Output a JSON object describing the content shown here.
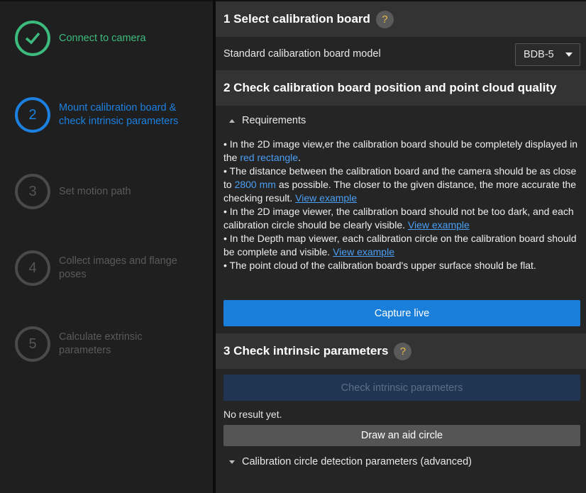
{
  "sidebar": {
    "steps": [
      {
        "num": "✓",
        "label": "Connect to camera",
        "state": "done"
      },
      {
        "num": "2",
        "label": "Mount calibration board & check intrinsic parameters",
        "state": "active"
      },
      {
        "num": "3",
        "label": "Set motion path",
        "state": "pending"
      },
      {
        "num": "4",
        "label": "Collect images and flange poses",
        "state": "pending"
      },
      {
        "num": "5",
        "label": "Calculate extrinsic parameters",
        "state": "pending"
      }
    ]
  },
  "section1": {
    "title": "1 Select calibration board",
    "help": "?",
    "model_label": "Standard calibaration board model",
    "model_value": "BDB-5"
  },
  "section2": {
    "title": "2 Check calibration board position and point cloud quality",
    "requirements_label": "Requirements",
    "t1a": "• In the 2D image view,er the calibration board should be completely displayed in the ",
    "t1b": "red rectangle",
    "t1c": ".",
    "t2a": "• The distance between the calibration board and the camera should be as close to ",
    "t2b": "2800 mm",
    "t2c": " as possible. The closer to the given distance, the more accurate the checking result. ",
    "link": "View example",
    "t3a": "• In the 2D image viewer, the calibration board should not be too dark, and each calibration circle should be clearly visible. ",
    "t4a": "• In the Depth map viewer, each calibration circle on the calibration board should be complete and visible. ",
    "t5": "• The point cloud of the calibration board's upper surface should be flat.",
    "capture_button": "Capture live"
  },
  "section3": {
    "title": "3 Check intrinsic parameters",
    "help": "?",
    "check_button": "Check intrinsic parameters",
    "result": "No result yet.",
    "draw_button": "Draw an aid circle",
    "advanced_label": "Calibration circle detection parameters (advanced)"
  },
  "colors": {
    "accent": "#1c80e0",
    "done": "#3dbb7e",
    "help_icon": "#e8b84a"
  }
}
